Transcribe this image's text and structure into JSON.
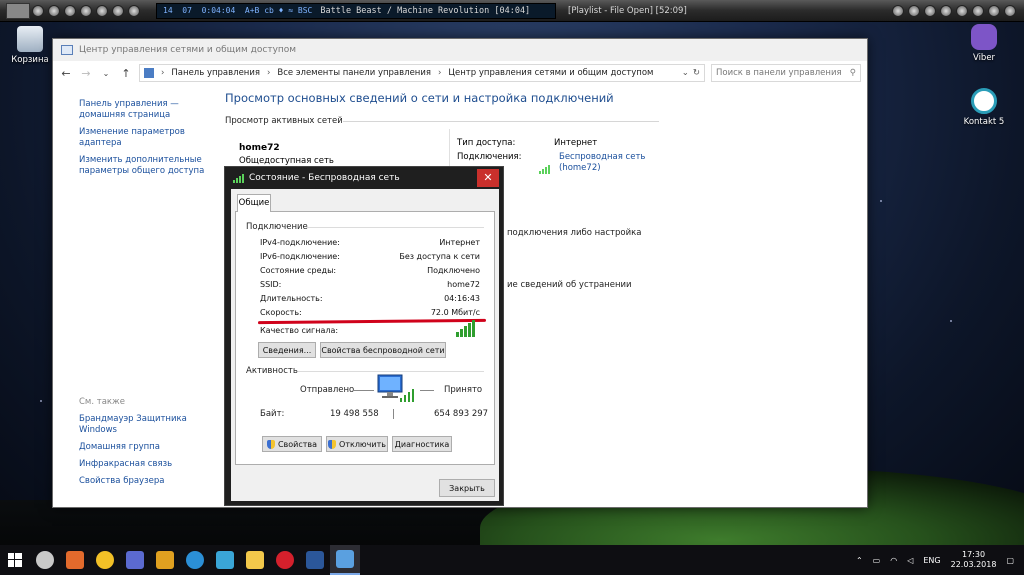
{
  "player": {
    "time_a": "14",
    "time_b": "07",
    "time_c": "0:04:04",
    "mode": "A+B  cb  ♦  ≈  BSC",
    "track": "Battle Beast / Machine Revolution  [04:04]",
    "playlist": "[Playlist - File Open]  [52:09]"
  },
  "desktop": {
    "recycle_bin": "Корзина",
    "viber": "Viber",
    "kontakt": "Kontakt 5"
  },
  "window": {
    "title": "Центр управления сетями и общим доступом",
    "breadcrumbs": [
      "Панель управления",
      "Все элементы панели управления",
      "Центр управления сетями и общим доступом"
    ],
    "search_placeholder": "Поиск в панели управления",
    "left_links": [
      "Панель управления — домашняя страница",
      "Изменение параметров адаптера",
      "Изменить дополнительные параметры общего доступа"
    ],
    "see_also": "См. также",
    "see_also_links": [
      "Брандмауэр Защитника Windows",
      "Домашняя группа",
      "Инфракрасная связь",
      "Свойства браузера"
    ],
    "main_title": "Просмотр основных сведений о сети и настройка подключений",
    "active_networks": "Просмотр активных сетей",
    "network_name": "home72",
    "network_type": "Общедоступная сеть",
    "access_type_label": "Тип доступа:",
    "access_type_value": "Интернет",
    "connections_label": "Подключения:",
    "connections_value": "Беспроводная сеть (home72)",
    "fragment_1": "подключения либо настройка",
    "fragment_2": "ие сведений об устранении"
  },
  "dialog": {
    "title": "Состояние - Беспроводная сеть",
    "tab": "Общие",
    "connection_group": "Подключение",
    "rows": [
      {
        "label": "IPv4-подключение:",
        "value": "Интернет"
      },
      {
        "label": "IPv6-подключение:",
        "value": "Без доступа к сети"
      },
      {
        "label": "Состояние среды:",
        "value": "Подключено"
      },
      {
        "label": "SSID:",
        "value": "home72"
      },
      {
        "label": "Длительность:",
        "value": "04:16:43"
      },
      {
        "label": "Скорость:",
        "value": "72.0 Мбит/с"
      }
    ],
    "signal_label": "Качество сигнала:",
    "details_button": "Сведения...",
    "wireless_props_button": "Свойства беспроводной сети",
    "activity_group": "Активность",
    "sent_label": "Отправлено",
    "received_label": "Принято",
    "bytes_label": "Байт:",
    "bytes_sent": "19 498 558",
    "bytes_received": "654 893 297",
    "properties_button": "Свойства",
    "disable_button": "Отключить",
    "diagnostics_button": "Диагностика",
    "close_button": "Закрыть"
  },
  "taskbar": {
    "lang": "ENG",
    "time": "17:30",
    "date": "22.03.2018"
  }
}
